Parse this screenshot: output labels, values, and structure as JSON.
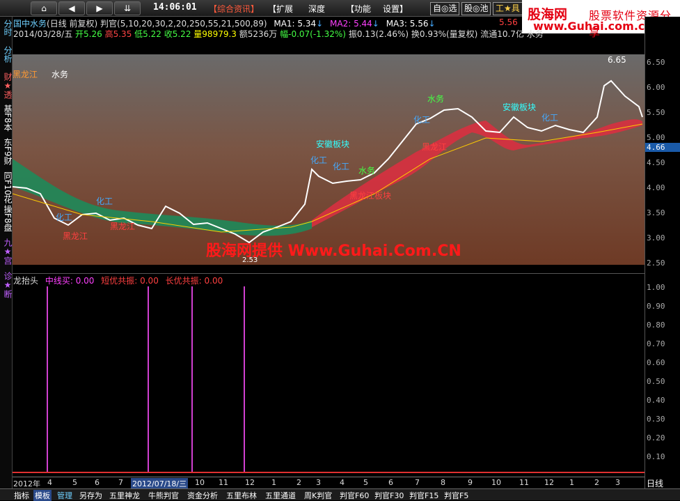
{
  "toolbar": {
    "nav": [
      "⌂",
      "◀",
      "▶",
      "⇊"
    ],
    "time": "14:06:01",
    "menus": [
      "【综合资讯】",
      "【扩展",
      "深度",
      "【功能",
      "设置】"
    ],
    "right_btns": [
      "自◎选",
      "股◎池",
      "工★具"
    ]
  },
  "banner": {
    "logo": "股海网",
    "slogan": "股票软件资源分享",
    "url": "www.Guhai.com.cn"
  },
  "sidebar": [
    "分时",
    "分析",
    "财★透",
    "基F8本",
    "东F9财",
    "同F10花",
    "操F8盘",
    "九★宫",
    "诊★断"
  ],
  "header": {
    "stock": "国中水务",
    "period": "(日线 前复权)",
    "indicator": "判官(5,10,20,30,2,20,250,55,21,500,89)",
    "ma1": "MA1: 5.34",
    "ma2": "MA2: 5.44",
    "ma3": "MA3: 5.56",
    "ma_extra": "5.56",
    "date": "2014/03/28/五",
    "open": "开5.26",
    "high": "高5.35",
    "low": "低5.22",
    "close": "收5.22",
    "vol": "量98979.3",
    "amount": "额5236万",
    "change": "幅-0.07(-1.32%)",
    "amp": "振0.13(2.46%)",
    "turnover": "换0.93%(量复权)",
    "float": "流通10.7亿",
    "industry": "水务"
  },
  "price_axis": [
    "6.50",
    "6.00",
    "5.50",
    "5.00",
    "4.50",
    "4.00",
    "3.50",
    "3.00",
    "2.50"
  ],
  "price_cur": "4.66",
  "chart_labels": {
    "l1": "黑龙江",
    "l2": "水务",
    "hi": "6.65",
    "lo": "2.53",
    "watermark": "股海网提供 Www.Guhai.Com.CN",
    "a1": "化工",
    "a2": "化工",
    "a3": "黑龙江",
    "a4": "黑龙江",
    "a5": "安徽板块",
    "a6": "化工",
    "a7": "化工",
    "a8": "水务",
    "a9": "黑龙江板块",
    "a10": "水务",
    "a11": "化工",
    "a12": "安徽板块",
    "a13": "化工",
    "a14": "黑龙江"
  },
  "sub": {
    "name": "龙抬头",
    "mid": "中线买: 0.00",
    "short": "短优共振: 0.00",
    "long": "长优共振: 0.00",
    "ticks": [
      "1.00",
      "0.90",
      "0.80",
      "0.70",
      "0.60",
      "0.50",
      "0.40",
      "0.30",
      "0.20",
      "0.10"
    ]
  },
  "timeline": {
    "labels": [
      "2012年",
      "4",
      "5",
      "6",
      "7",
      "2012/07/18/三",
      "10",
      "11",
      "12",
      "1",
      "2",
      "3",
      "4",
      "5",
      "6",
      "7",
      "8",
      "9",
      "10",
      "11",
      "12",
      "1",
      "2",
      "3"
    ],
    "period": "日线"
  },
  "bottom_tabs": [
    "指标",
    "模板",
    "管理",
    "另存为",
    "五里神龙",
    "牛熊判官",
    "资金分析",
    "五里布林",
    "五里通道",
    "周K判官",
    "判官F60",
    "判官F30",
    "判官F15",
    "判官F5"
  ],
  "colors": {
    "bg": "#000000",
    "ribbon_red": "#d83040",
    "ribbon_green": "#1f8a5a",
    "accent": "#ff3030"
  }
}
